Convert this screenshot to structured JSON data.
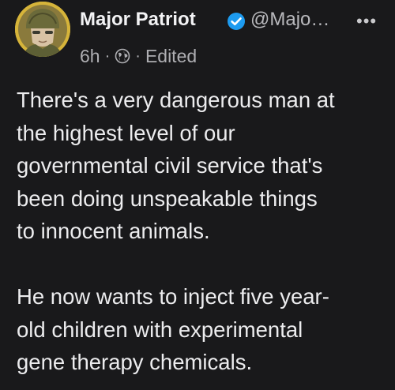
{
  "post": {
    "author": {
      "name": "Major Patriot",
      "handle": "@Majo…",
      "verified": true,
      "avatar": "soldier-avatar"
    },
    "meta": {
      "time": "6h",
      "separator": "·",
      "audience_icon": "globe-icon",
      "edited_label": "Edited"
    },
    "more_icon": "•••",
    "paragraphs": [
      "There's a very dangerous man at\nthe highest level of our\ngovernmental civil service that's\nbeen doing unspeakable things\nto innocent animals.",
      "He now wants to inject five year-\nold children with experimental\ngene therapy chemicals."
    ]
  },
  "colors": {
    "background": "#19191b",
    "text": "#ececee",
    "muted": "#aeaeb2",
    "verified_badge": "#1d9bf0",
    "avatar_bg": "#d8b73a"
  }
}
